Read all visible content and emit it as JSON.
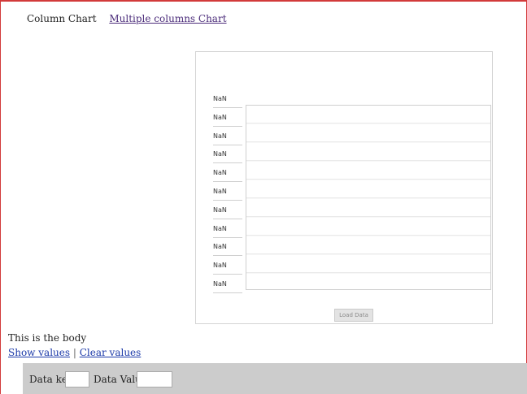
{
  "nav": {
    "tab_column": "Column Chart",
    "tab_multiple": "Multiple columns Chart"
  },
  "chart_data": {
    "type": "bar",
    "title": "",
    "y_tick_labels": [
      "NaN",
      "NaN",
      "NaN",
      "NaN",
      "NaN",
      "NaN",
      "NaN",
      "NaN",
      "NaN",
      "NaN",
      "NaN"
    ],
    "categories": [],
    "values": [],
    "grid": true
  },
  "chart": {
    "load_label": "Load Data"
  },
  "body": {
    "text": "This is the body",
    "show_values": "Show values",
    "separator": "|",
    "clear_values": "Clear values"
  },
  "form": {
    "key_label": "Data key",
    "key_value": "",
    "value_label": "Data Value",
    "value_value": ""
  },
  "colors": {
    "frame_border": "#d23a3a",
    "link_visited": "#4b2c7a",
    "link": "#1c3aa9",
    "form_bar": "#cccccc"
  }
}
